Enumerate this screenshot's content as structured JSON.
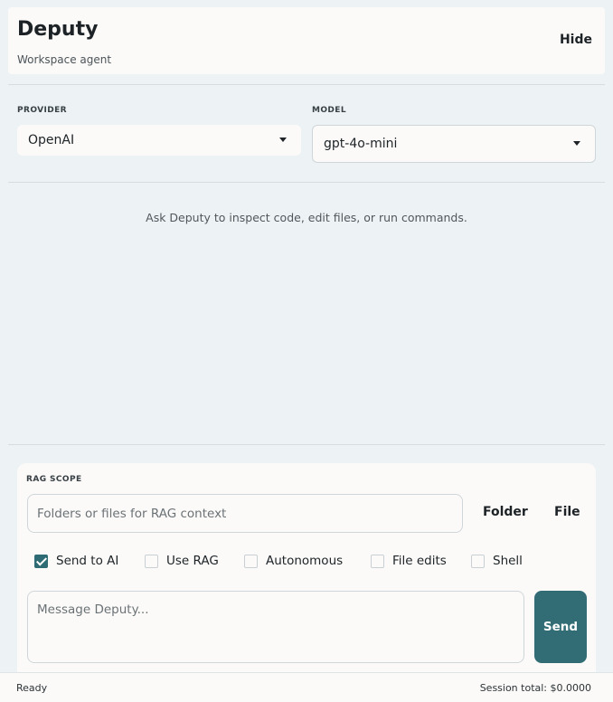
{
  "header": {
    "title": "Deputy",
    "subtitle": "Workspace agent",
    "hide_label": "Hide"
  },
  "provider": {
    "label": "PROVIDER",
    "value": "OpenAI"
  },
  "model": {
    "label": "MODEL",
    "value": "gpt-4o-mini"
  },
  "conversation": {
    "empty_message": "Ask Deputy to inspect code, edit files, or run commands."
  },
  "rag": {
    "label": "RAG SCOPE",
    "placeholder": "Folders or files for RAG context",
    "folder_label": "Folder",
    "file_label": "File"
  },
  "options": [
    {
      "label": "Send to AI",
      "checked": true
    },
    {
      "label": "Use RAG",
      "checked": false
    },
    {
      "label": "Autonomous",
      "checked": false
    },
    {
      "label": "File edits",
      "checked": false
    },
    {
      "label": "Shell",
      "checked": false
    }
  ],
  "composer": {
    "placeholder": "Message Deputy...",
    "send_label": "Send"
  },
  "status": {
    "state": "Ready",
    "session_total": "Session total: $0.0000"
  },
  "colors": {
    "accent": "#326d76",
    "panel": "#fbfaf8",
    "background": "#edf2f5"
  },
  "icons": {
    "dropdown": "caret-down-icon",
    "checkbox_checked": "checkmark-icon"
  }
}
